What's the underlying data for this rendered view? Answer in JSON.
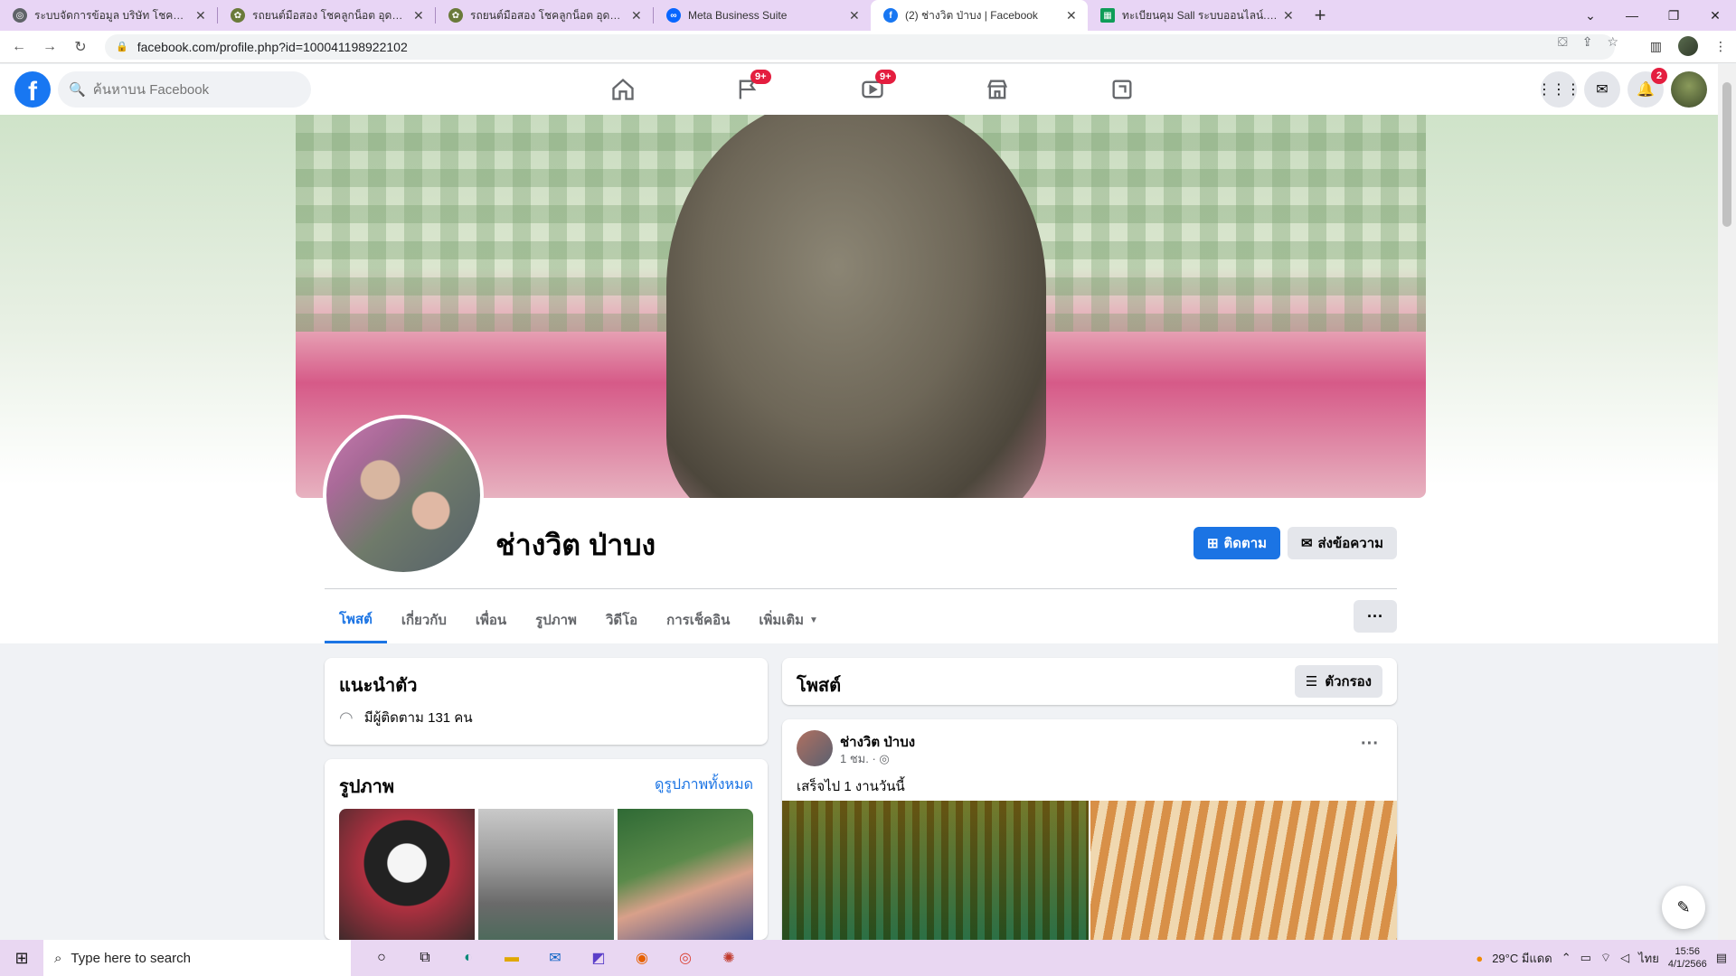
{
  "browser": {
    "tabs": [
      {
        "title": "ระบบจัดการข้อมูล บริษัท โชคลูกน็อต อุดรธานี",
        "fav_color": "#5f6368",
        "active": false
      },
      {
        "title": "รถยนต์มือสอง โชคลูกน็อต อุดรธานี",
        "fav_color": "#6a7a3a",
        "active": false
      },
      {
        "title": "รถยนต์มือสอง โชคลูกน็อต อุดรธานี",
        "fav_color": "#6a7a3a",
        "active": false
      },
      {
        "title": "Meta Business Suite",
        "fav_color": "#0866ff",
        "active": false
      },
      {
        "title": "(2) ช่างวิต ป่าบง | Facebook",
        "fav_color": "#1877f2",
        "active": true
      },
      {
        "title": "ทะเบียนคุม Sall ระบบออนไลน์.xlsx - G",
        "fav_color": "#0f9d58",
        "active": false
      }
    ],
    "url": "facebook.com/profile.php?id=100041198922102"
  },
  "fb": {
    "search_placeholder": "ค้นหาบน Facebook",
    "nav_badges": {
      "groups": "9+",
      "watch": "9+"
    },
    "notif_badge": "2"
  },
  "profile": {
    "name": "ช่างวิต ป่าบง",
    "follow_label": "ติดตาม",
    "message_label": "ส่งข้อความ",
    "tabs": [
      "โพสต์",
      "เกี่ยวกับ",
      "เพื่อน",
      "รูปภาพ",
      "วิดีโอ",
      "การเช็คอิน",
      "เพิ่มเติม"
    ],
    "more_dots": "···"
  },
  "intro": {
    "title": "แนะนำตัว",
    "followers_text": "มีผู้ติดตาม 131 คน"
  },
  "photos": {
    "title": "รูปภาพ",
    "see_all": "ดูรูปภาพทั้งหมด"
  },
  "posts": {
    "title": "โพสต์",
    "filter_label": "ตัวกรอง",
    "items": [
      {
        "author": "ช่างวิต ป่าบง",
        "time": "1 ชม. ·",
        "text": "เสร็จไป 1 งานวันนี้"
      }
    ]
  },
  "taskbar": {
    "search_placeholder": "Type here to search",
    "weather": "29°C มีแดด",
    "lang": "ไทย",
    "time": "15:56",
    "date": "4/1/2566"
  }
}
